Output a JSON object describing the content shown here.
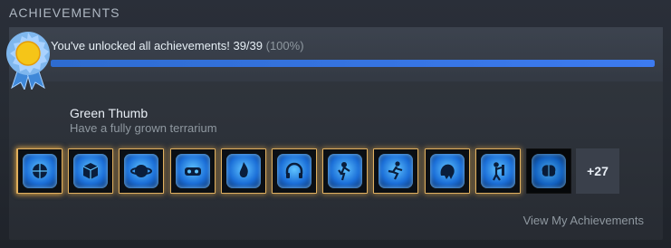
{
  "section": {
    "title": "ACHIEVEMENTS"
  },
  "progress": {
    "text": "You've unlocked all achievements! 39/39",
    "percent_text": "(100%)",
    "fraction": 1.0
  },
  "featured": {
    "name": "Green Thumb",
    "description": "Have a fully grown terrarium",
    "icon": "tree-icon"
  },
  "achievements": [
    {
      "icon": "globe-icon",
      "unlocked": true
    },
    {
      "icon": "cube-icon",
      "unlocked": true
    },
    {
      "icon": "planet-icon",
      "unlocked": true
    },
    {
      "icon": "vr-headset-icon",
      "unlocked": true
    },
    {
      "icon": "flame-icon",
      "unlocked": true
    },
    {
      "icon": "headphones-icon",
      "unlocked": true
    },
    {
      "icon": "person-icon",
      "unlocked": true
    },
    {
      "icon": "runner-icon",
      "unlocked": true
    },
    {
      "icon": "creature-icon",
      "unlocked": true
    },
    {
      "icon": "figure-icon",
      "unlocked": true
    },
    {
      "icon": "brain-icon",
      "unlocked": false
    }
  ],
  "more": {
    "label": "+27"
  },
  "link": {
    "label": "View My Achievements"
  },
  "colors": {
    "accent_bar": "#3d7bf0",
    "medal_gold": "#f5c518",
    "tile_blue": "#1b6fd8",
    "border_gold": "#e0b060"
  }
}
